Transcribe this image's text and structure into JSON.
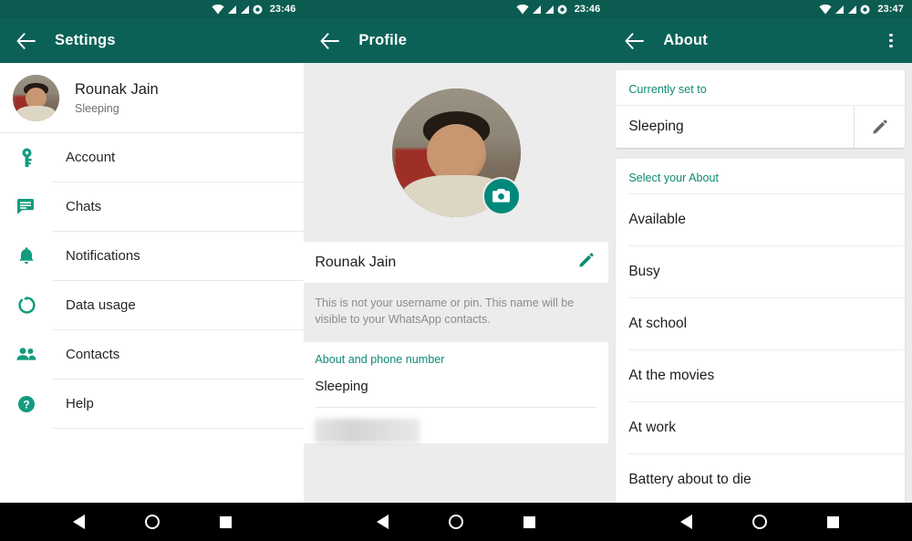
{
  "device": {
    "nav": {
      "back_label": "Back",
      "home_label": "Home",
      "recents_label": "Recent apps"
    }
  },
  "panels": [
    {
      "id": "settings",
      "statusbar": {
        "time": "23:46",
        "wifi": "wifi-icon",
        "signal1": "signal-icon",
        "signal2": "signal-icon",
        "dot": "status-dot-icon"
      },
      "appbar": {
        "back": "back-arrow-icon",
        "title": "Settings"
      },
      "profile": {
        "name": "Rounak Jain",
        "status": "Sleeping",
        "avatar": "user-avatar"
      },
      "menu": [
        {
          "label": "Account",
          "icon": "key-icon"
        },
        {
          "label": "Chats",
          "icon": "chat-bubble-icon"
        },
        {
          "label": "Notifications",
          "icon": "bell-icon"
        },
        {
          "label": "Data usage",
          "icon": "data-usage-icon"
        },
        {
          "label": "Contacts",
          "icon": "contacts-icon"
        },
        {
          "label": "Help",
          "icon": "help-icon"
        }
      ]
    },
    {
      "id": "profile",
      "statusbar": {
        "time": "23:46"
      },
      "appbar": {
        "back": "back-arrow-icon",
        "title": "Profile"
      },
      "photo": {
        "avatar": "user-avatar-large",
        "camera_button": "camera-icon"
      },
      "name_row": {
        "value": "Rounak Jain",
        "edit_icon": "pencil-icon"
      },
      "hint": "This is not your username or pin. This name will be visible to your WhatsApp contacts.",
      "about_section": {
        "header": "About and phone number",
        "about_value": "Sleeping",
        "phone_value": ""
      }
    },
    {
      "id": "about",
      "statusbar": {
        "time": "23:47"
      },
      "appbar": {
        "back": "back-arrow-icon",
        "title": "About",
        "overflow": "overflow-menu-icon"
      },
      "current": {
        "header": "Currently set to",
        "value": "Sleeping",
        "edit_icon": "pencil-icon"
      },
      "select": {
        "header": "Select your About",
        "options": [
          "Available",
          "Busy",
          "At school",
          "At the movies",
          "At work",
          "Battery about to die"
        ]
      }
    }
  ],
  "colors": {
    "appbar": "#0c6157",
    "statusbar": "#0b5b51",
    "accent_green": "#0f8a72",
    "icon_green": "#139b7f",
    "camera_button": "#00897b",
    "panel_bg": "#ececec",
    "card_bg": "#ffffff",
    "navbar": "#000000"
  }
}
